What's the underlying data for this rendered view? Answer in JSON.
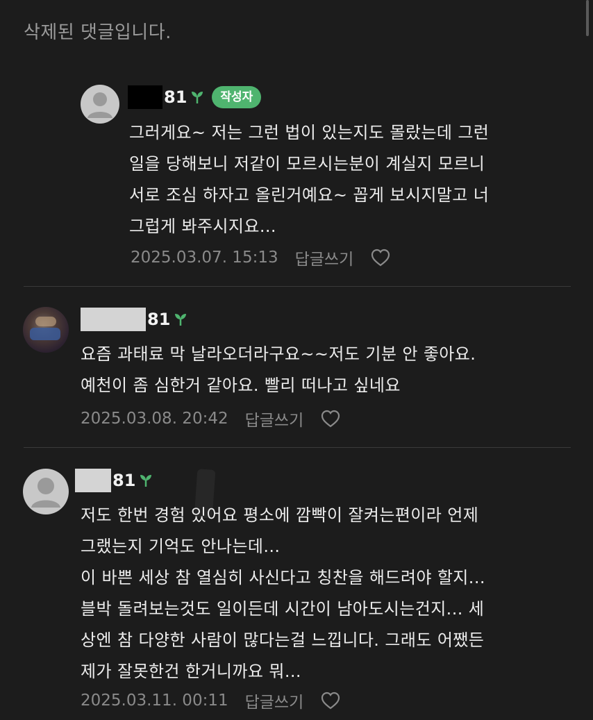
{
  "deleted_notice": "삭제된 댓글입니다.",
  "badge_author": "작성자",
  "icons": {
    "sprout": "sprout-icon",
    "heart": "heart-icon",
    "avatar_default": "default-avatar-icon"
  },
  "colors": {
    "background": "#1c1c1c",
    "badge": "#4fb46f",
    "sprout": "#4fb46f"
  },
  "comments": [
    {
      "nickname_suffix": "81",
      "is_author": true,
      "text": "그러게요~ 저는 그런 법이 있는지도 몰랐는데 그런\n일을 당해보니 저같이 모르시는분이 계실지 모르니\n서로 조심 하자고 올린거예요~ 꼽게 보시지말고 너\n그럽게 봐주시지요...",
      "date": "2025.03.07. 15:13",
      "reply_label": "답글쓰기"
    },
    {
      "nickname_suffix": "81",
      "is_author": false,
      "text": "요즘 과태료 막 날라오더라구요~~저도 기분 안 좋아요.\n예천이 좀 심한거 같아요. 빨리 떠나고 싶네요",
      "date": "2025.03.08. 20:42",
      "reply_label": "답글쓰기"
    },
    {
      "nickname_suffix": "81",
      "is_author": false,
      "text": "저도 한번 경험 있어요 평소에 깜빡이 잘켜는편이라 언제\n그랬는지 기억도 안나는데...\n이 바쁜 세상 참 열심히 사신다고 칭찬을 해드려야 할지...\n블박 돌려보는것도 일이든데 시간이 남아도시는건지... 세\n상엔 참 다양한 사람이 많다는걸 느낍니다. 그래도 어쨌든\n제가 잘못한건 한거니까요 뭐...",
      "date": "2025.03.11. 00:11",
      "reply_label": "답글쓰기"
    }
  ]
}
